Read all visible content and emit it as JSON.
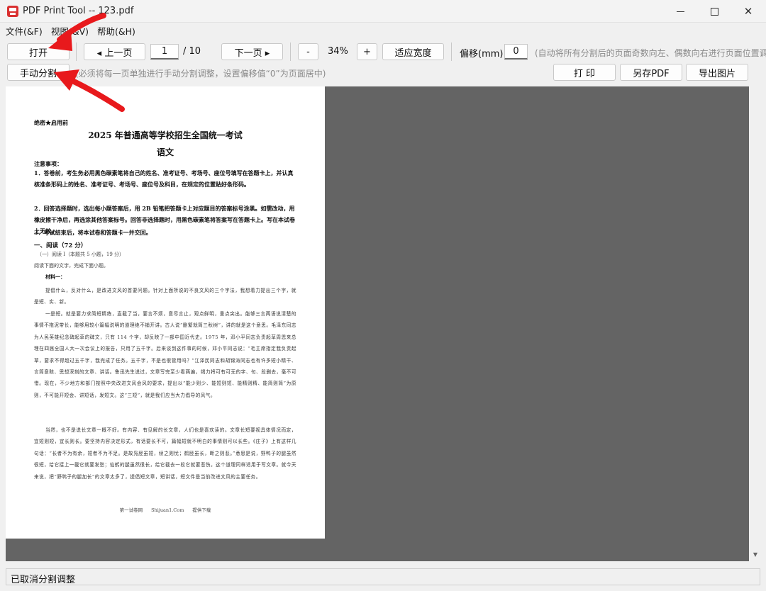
{
  "window": {
    "title": "PDF Print Tool -- 123.pdf"
  },
  "menu": {
    "file": "文件(&F)",
    "view": "视图(&V)",
    "help": "帮助(&H)"
  },
  "toolbar": {
    "open": "打开",
    "prev_page": "◂ 上一页",
    "page_current": "1",
    "page_total": "/ 10",
    "next_page": "下一页 ▸",
    "zoom_out": "-",
    "zoom_level": "34%",
    "zoom_in": "+",
    "fit_width": "适应宽度",
    "offset_label": "偏移(mm):",
    "offset_value": "0",
    "offset_hint": "(自动将所有分割后的页面奇数向左、偶数向右进行页面位置调整",
    "manual_split": "手动分割",
    "manual_hint": "(必须将每一页单独进行手动分割调整，设置偏移值“0”为页面居中)",
    "print": "打 印",
    "save_pdf": "另存PDF",
    "export_image": "导出图片"
  },
  "document": {
    "secret": "绝密★启用前",
    "title": "2025 年普通高等学校招生全国统一考试",
    "subject": "语文",
    "notice_title": "注意事项：",
    "notices": [
      "1．答卷前，考生务必用黑色碳素笔将自己的姓名、准考证号、考场号、座位号填写在答题卡上，并认真核准条形码上的姓名、准考证号、考场号、座位号及科目，在规定的位置贴好条形码。",
      "2．回答选择题时，选出每小题答案后，用 2B 铅笔把答题卡上对应题目的答案标号涂黑。如需改动，用橡皮擦干净后，再选涂其他答案标号。回答非选择题时，用黑色碳素笔将答案写在答题卡上。写在本试卷上无效。",
      "3．考试结束后，将本试卷和答题卡一并交回。"
    ],
    "section": "一、阅读（72 分）",
    "subsection": "（一）阅读 I（本题共 5 小题，19 分）",
    "instruction": "阅读下面的文字，完成下面小题。",
    "material": "材料一：",
    "paragraphs": [
      "提倡什么，反对什么，是改进文风的首要问题。针对上面所说的不良文风的三个字法，我想着力提出三个字，就是短、实、新。",
      "一是短。就是要力求简短精练，直截了当，要言不烦，意尽言止，观点鲜明，重点突出。能够三言两语说清楚的事情不拖泥带长，能够用较小篇幅说明的道理绝不铺开讲。古人说“删繁就简三秋树”，讲的就是这个意思。毛泽东同志为人民英雄纪念碑起草的碑文，只有 114 个字，却反映了一部中国近代史。1975 年，邓小平同志负责起草周恩来总理在四届全国人大一次会议上的报告，只用了五千字。后来谈到这件事的时候，邓小平同志说：“毛主席指定我负责起草，要求不得超过五千字，我完成了任务。五千字，不是也很管用吗？”江泽民同志和胡锦涛同志也有许多短小精干、言简意赅、思想深刻的文章、讲话。鲁迅先生说过，文章写完至少看两遍，竭力将可有可无的字、句、段删去，毫不可惜。现在，不少地方和部门按照中央改进文风会风的要求，提出以“能少则少、能短则短、能精则精、能简则简”为原则，不可能开短会、讲短话，发短文。这“三短”，就是我们应当大力倡导的风气。",
      "当然，也不是说长文章一概不好。有内容、有见解的长文章，人们也是喜欢读的。文章长短要视具体情况而定，宜短则短，宜长则长。要坚持内容决定形式，有话要长不可，篇幅短就不明白的事情则可以长些。《庄子》上有这样几句话：“长者不为有余，短者不为不足。是故凫胫虽短，续之则忧；鹤胫虽长，断之则悲。”意思是说，野鸭子的腿虽然很短，给它接上一截它就要发愁；仙鹤的腿虽然很长，给它截去一段它就要悲伤。这个道理同样适用于写文章。就今天来说，把“野鸭子的腿加长”的文章太多了，提倡短文章，短讲话，短文件是当前改进文风的主要任务。"
    ],
    "footer": "第一试卷网 Shijuan1.Com 提供下载"
  },
  "status": {
    "text": "已取消分割调整"
  }
}
